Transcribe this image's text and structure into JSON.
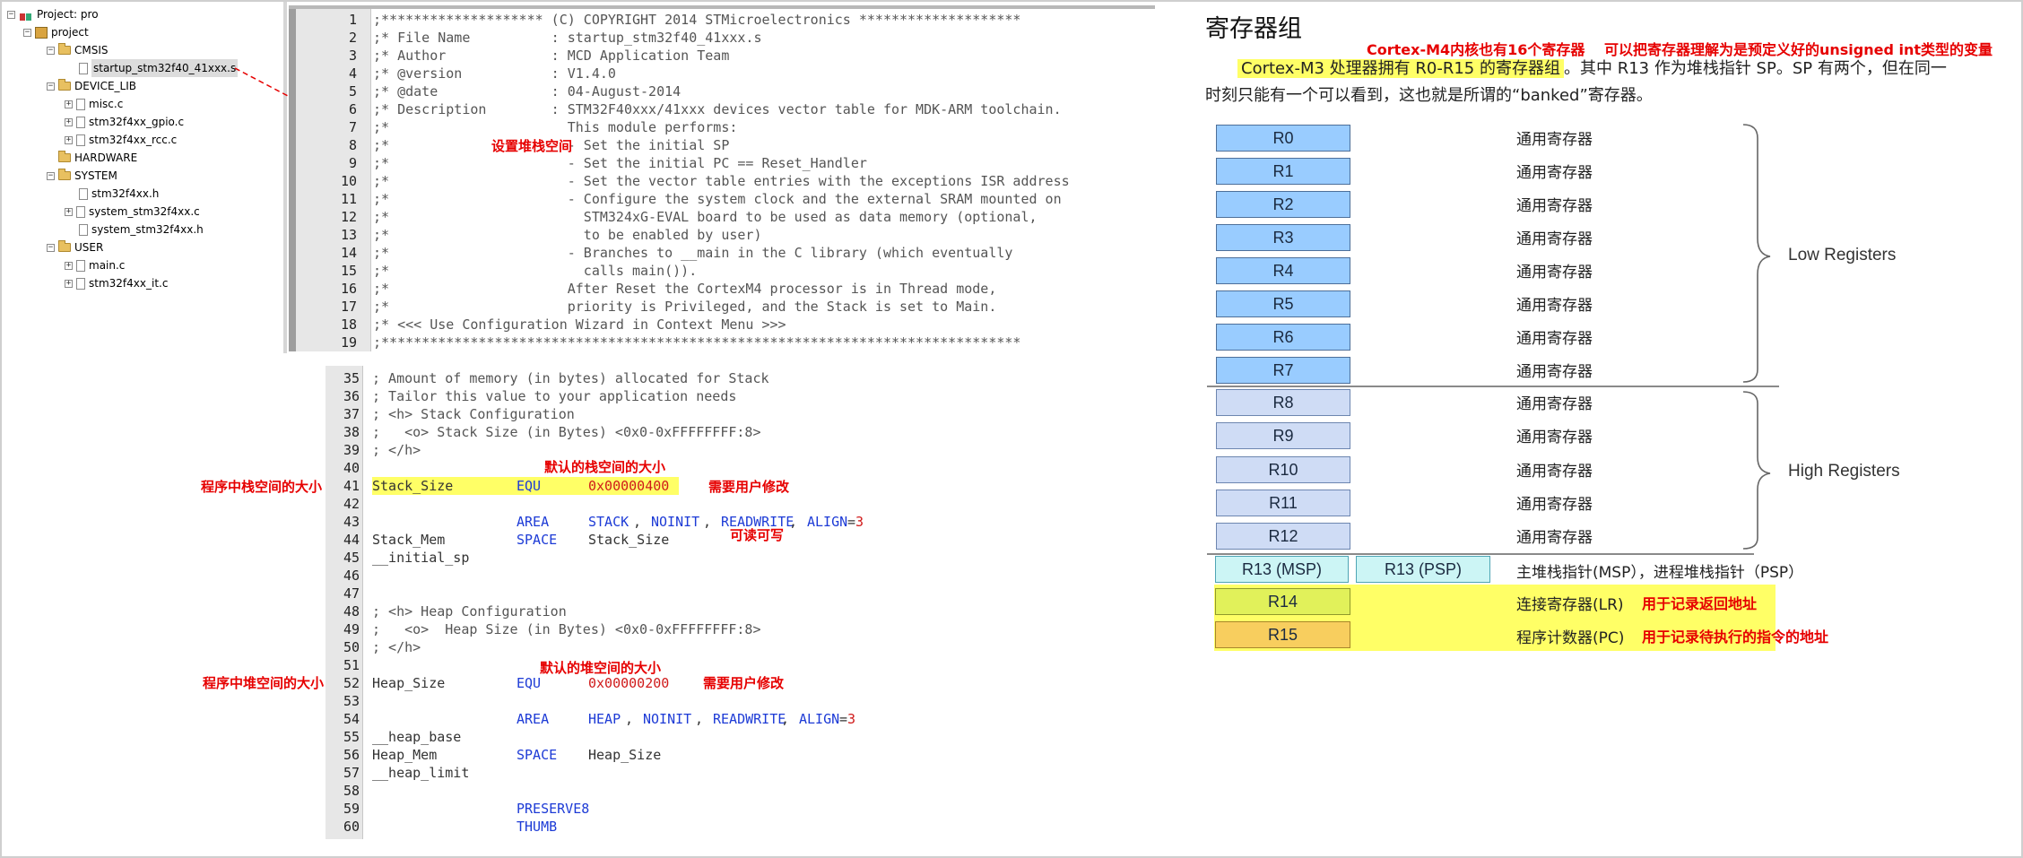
{
  "project_tree": {
    "root_label": "Project: pro",
    "project_label": "project",
    "groups": [
      {
        "name": "CMSIS",
        "files": [
          "startup_stm32f40_41xxx.s"
        ]
      },
      {
        "name": "DEVICE_LIB",
        "files": [
          "misc.c",
          "stm32f4xx_gpio.c",
          "stm32f4xx_rcc.c"
        ]
      },
      {
        "name": "HARDWARE",
        "files": []
      },
      {
        "name": "SYSTEM",
        "files": [
          "stm32f4xx.h",
          "system_stm32f4xx.c",
          "system_stm32f4xx.h"
        ]
      },
      {
        "name": "USER",
        "files": [
          "main.c",
          "stm32f4xx_it.c"
        ]
      }
    ]
  },
  "code_top": {
    "lines": [
      {
        "n": "1",
        "t": ";******************** (C) COPYRIGHT 2014 STMicroelectronics ********************"
      },
      {
        "n": "2",
        "t": ";* File Name          : startup_stm32f40_41xxx.s"
      },
      {
        "n": "3",
        "t": ";* Author             : MCD Application Team"
      },
      {
        "n": "4",
        "t": ";* @version           : V1.4.0"
      },
      {
        "n": "5",
        "t": ";* @date              : 04-August-2014"
      },
      {
        "n": "6",
        "t": ";* Description        : STM32F40xxx/41xxx devices vector table for MDK-ARM toolchain."
      },
      {
        "n": "7",
        "t": ";*                      This module performs:"
      },
      {
        "n": "8",
        "t": ";*                      - Set the initial SP"
      },
      {
        "n": "9",
        "t": ";*                      - Set the initial PC == Reset_Handler"
      },
      {
        "n": "10",
        "t": ";*                      - Set the vector table entries with the exceptions ISR address"
      },
      {
        "n": "11",
        "t": ";*                      - Configure the system clock and the external SRAM mounted on"
      },
      {
        "n": "12",
        "t": ";*                        STM324xG-EVAL board to be used as data memory (optional,"
      },
      {
        "n": "13",
        "t": ";*                        to be enabled by user)"
      },
      {
        "n": "14",
        "t": ";*                      - Branches to __main in the C library (which eventually"
      },
      {
        "n": "15",
        "t": ";*                        calls main())."
      },
      {
        "n": "16",
        "t": ";*                      After Reset the CortexM4 processor is in Thread mode,"
      },
      {
        "n": "17",
        "t": ";*                      priority is Privileged, and the Stack is set to Main."
      },
      {
        "n": "18",
        "t": ";* <<< Use Configuration Wizard in Context Menu >>>"
      },
      {
        "n": "19",
        "t": ";*******************************************************************************"
      }
    ]
  },
  "code_bottom": {
    "numbers": [
      "35",
      "36",
      "37",
      "38",
      "39",
      "40",
      "41",
      "42",
      "43",
      "44",
      "45",
      "46",
      "47",
      "48",
      "49",
      "50",
      "51",
      "52",
      "53",
      "54",
      "55",
      "56",
      "57",
      "58",
      "59",
      "60"
    ],
    "l35": "; Amount of memory (in bytes) allocated for Stack",
    "l36": "; Tailor this value to your application needs",
    "l37": "; <h> Stack Configuration",
    "l38": ";   <o> Stack Size (in Bytes) <0x0-0xFFFFFFFF:8>",
    "l39": "; </h>",
    "l41_label": "Stack_Size      ",
    "l41_kw": "EQU",
    "l41_val": "0x00000400",
    "l43_kw": "AREA",
    "l43_a": "STACK",
    "l43_b": "NOINIT",
    "l43_c": "READWRITE",
    "l43_d": "ALIGN",
    "l43_e": "3",
    "l44_label": "Stack_Mem",
    "l44_kw": "SPACE",
    "l44_arg": "Stack_Size",
    "l45": "__initial_sp",
    "l48": "; <h> Heap Configuration",
    "l49": ";   <o>  Heap Size (in Bytes) <0x0-0xFFFFFFFF:8>",
    "l50": "; </h>",
    "l52_label": "Heap_Size",
    "l52_kw": "EQU",
    "l52_val": "0x00000200",
    "l54_kw": "AREA",
    "l54_a": "HEAP",
    "l54_b": "NOINIT",
    "l54_c": "READWRITE",
    "l54_d": "ALIGN",
    "l54_e": "3",
    "l55": "__heap_base",
    "l56_label": "Heap_Mem",
    "l56_kw": "SPACE",
    "l56_arg": "Heap_Size",
    "l57": "__heap_limit",
    "l59_kw": "PRESERVE8",
    "l60_kw": "THUMB"
  },
  "annotations": {
    "set_stack": "设置堆栈空间",
    "stack_default": "默认的栈空间的大小",
    "stack_size_in_program": "程序中栈空间的大小",
    "stack_user_modify": "需要用户修改",
    "readable_writable": "可读可写",
    "heap_default": "默认的堆空间的大小",
    "heap_size_in_program": "程序中堆空间的大小",
    "heap_user_modify": "需要用户修改"
  },
  "registers": {
    "title": "寄存器组",
    "note_m4": "Cortex-M4内核也有16个寄存器",
    "note_unsigned": "可以把寄存器理解为是预定义好的unsigned int类型的变量",
    "para_hl": "Cortex-M3 处理器拥有 R0-R15 的寄存器组",
    "para_rest": "。其中 R13 作为堆栈指针 SP。SP 有两个，但在同一",
    "para_line2": "时刻只能有一个可以看到，这也就是所谓的“banked”寄存器。",
    "low_label": "Low Registers",
    "high_label": "High Registers",
    "low": [
      {
        "name": "R0",
        "desc": "通用寄存器"
      },
      {
        "name": "R1",
        "desc": "通用寄存器"
      },
      {
        "name": "R2",
        "desc": "通用寄存器"
      },
      {
        "name": "R3",
        "desc": "通用寄存器"
      },
      {
        "name": "R4",
        "desc": "通用寄存器"
      },
      {
        "name": "R5",
        "desc": "通用寄存器"
      },
      {
        "name": "R6",
        "desc": "通用寄存器"
      },
      {
        "name": "R7",
        "desc": "通用寄存器"
      }
    ],
    "high": [
      {
        "name": "R8",
        "desc": "通用寄存器"
      },
      {
        "name": "R9",
        "desc": "通用寄存器"
      },
      {
        "name": "R10",
        "desc": "通用寄存器"
      },
      {
        "name": "R11",
        "desc": "通用寄存器"
      },
      {
        "name": "R12",
        "desc": "通用寄存器"
      }
    ],
    "r13_msp": "R13 (MSP)",
    "r13_psp": "R13 (PSP)",
    "r13_desc": "主堆栈指针(MSP），进程堆栈指针（PSP）",
    "r14": "R14",
    "r14_desc": "连接寄存器(LR)",
    "r14_note": "用于记录返回地址",
    "r15": "R15",
    "r15_desc": "程序计数器(PC)",
    "r15_note": "用于记录待执行的指令的地址",
    "colors": {
      "low_fill": "#99ccff",
      "high_fill": "#cfdcf5",
      "r13_fill": "#ccf5f5",
      "r14_fill": "#e1f15a",
      "r15_fill": "#f8ce5e",
      "highlight": "#ffff66",
      "annotation_red": "#e60000"
    }
  }
}
